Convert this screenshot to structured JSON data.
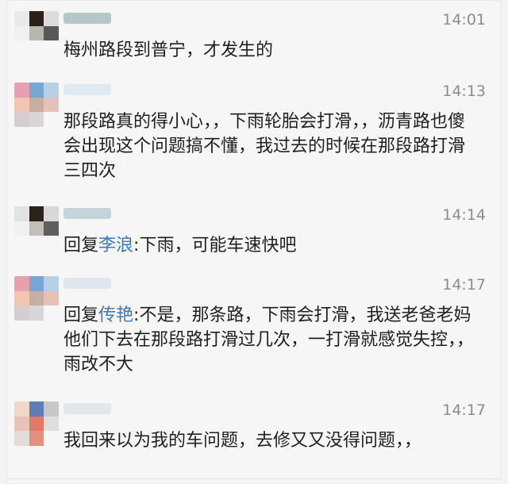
{
  "messages": [
    {
      "time": "14:01",
      "text": "梅州路段到普宁，才发生的"
    },
    {
      "time": "14:13",
      "text": "那段路真的得小心，，下雨轮胎会打滑，，沥青路也傻会出现这个问题搞不懂，我过去的时候在那段路打滑三四次"
    },
    {
      "time": "14:14",
      "prefix": "回复",
      "mention": "李浪",
      "rest": ":下雨，可能车速快吧"
    },
    {
      "time": "14:17",
      "prefix": "回复",
      "mention": "传艳",
      "rest": ":不是，那条路，下雨会打滑，我送老爸老妈他们下去在那段路打滑过几次，一打滑就感觉失控，，雨改不大"
    },
    {
      "time": "14:17",
      "text": "我回来以为我的车问题，去修又又没得问题，，"
    }
  ]
}
